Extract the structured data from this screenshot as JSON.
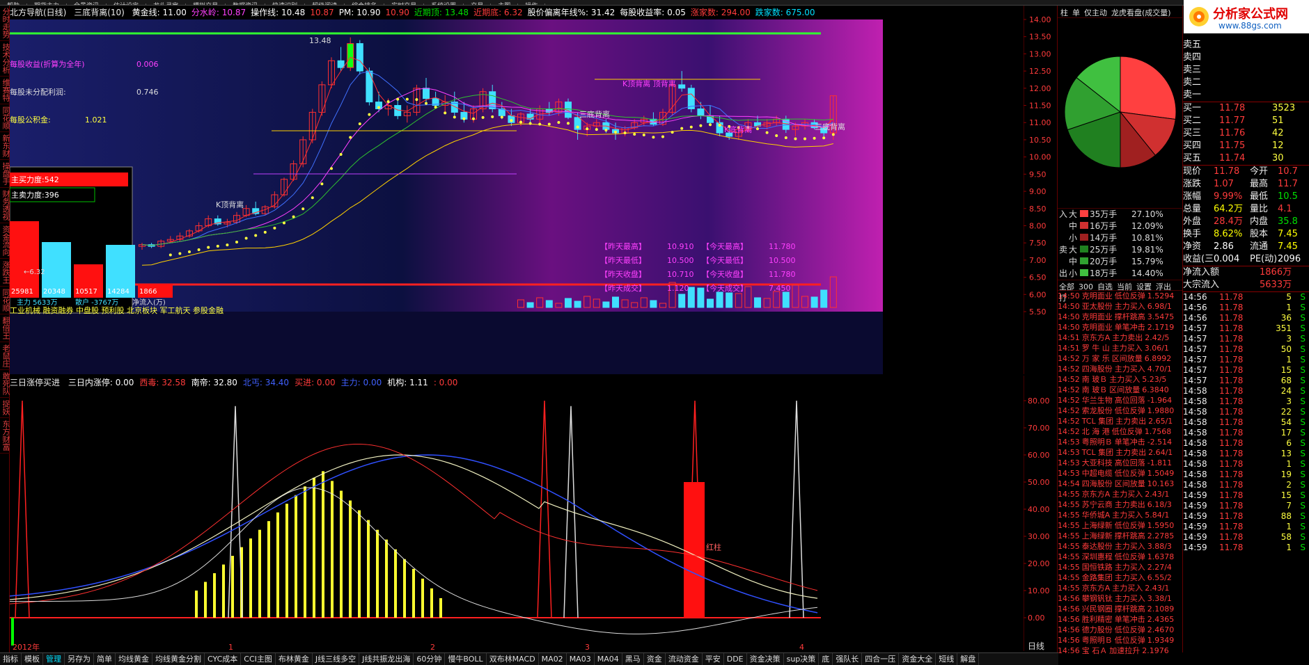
{
  "menu": [
    "帮助",
    "期货主力",
    "全景资讯",
    "估计设定",
    "龙头寻宝",
    "模拟交易",
    "数据资讯",
    "快速识别",
    "超级阅读",
    "综合排名",
    "实时交易",
    "系统设置",
    "交易",
    "主图",
    "操作"
  ],
  "left_nav": [
    "分时走势",
    "技术分析",
    "维赛特",
    "同花顺",
    "新东财",
    "操盘手",
    "财务透视",
    "资金流向",
    "涨跌王",
    "同花顺",
    "翻倍王",
    "老鼠庄",
    "敢死队",
    "捉妖",
    "东方财富"
  ],
  "main_header": {
    "title": "北方导航(日线)",
    "indicator": "三底背离(10)",
    "items": [
      {
        "label": "黄金线: 11.00",
        "color": "#ffffff"
      },
      {
        "label": "分水岭: 10.87",
        "color": "#ff40ff"
      },
      {
        "label": "操作线: 10.48",
        "color": "#ffffff"
      },
      {
        "label": "10.87",
        "color": "#ff3b3b"
      },
      {
        "label": "PM: 10.90",
        "color": "#ffffff"
      },
      {
        "label": "10.90",
        "color": "#ff3b3b"
      },
      {
        "label": "近期顶: 13.48",
        "color": "#00e000"
      },
      {
        "label": "近期底: 6.32",
        "color": "#ff3b3b"
      },
      {
        "label": "股价偏离年线%: 31.42",
        "color": "#ffffff"
      },
      {
        "label": "每股收益率: 0.05",
        "color": "#ffffff"
      },
      {
        "label": "涨家数: 294.00",
        "color": "#ff3b3b"
      },
      {
        "label": "跌家数: 675.00",
        "color": "#00e0ff"
      }
    ]
  },
  "main_overlay": {
    "eps_label": "每股收益(折算为全年)",
    "eps_value": "0.006",
    "undist_label": "每股未分配利润:",
    "undist_value": "0.746",
    "reserve_label": "每股公积金:",
    "reserve_value": "1.021",
    "buy_strength": "主买力度:542",
    "sell_strength": "主卖力度:396",
    "bars": [
      "25981",
      "20348",
      "10517",
      "14284",
      "1866"
    ],
    "arrow_low": "6.32",
    "flow_label_a": "主力 5633万",
    "flow_label_b": "散户 -3767万",
    "flow_label_c": "净流入(万)",
    "concept": "工业机械 融资融券 中盘股 预利股 北京板块 军工航天 参股金融",
    "peak_label": "13.48",
    "k_top_label": "K顶背离",
    "k_top_label2": "K顶背离 顶背离",
    "bottom_div": "三底背离",
    "bottom_div2": "K底背离",
    "bottom_div3": "三底背离",
    "stats": [
      {
        "label": "【昨天最高】",
        "value": "10.910",
        "label2": "【今天最高】",
        "value2": "11.780"
      },
      {
        "label": "【昨天最低】",
        "value": "10.500",
        "label2": "【今天最低】",
        "value2": "10.500"
      },
      {
        "label": "【昨天收盘】",
        "value": "10.710",
        "label2": "【今天收盘】",
        "value2": "11.780"
      },
      {
        "label": "【昨天成交】",
        "value": "1.120",
        "label2": "【今天成交】",
        "value2": "7.450"
      }
    ]
  },
  "price_axis": [
    "14.00",
    "13.50",
    "13.00",
    "12.50",
    "12.00",
    "11.50",
    "11.00",
    "10.50",
    "10.00",
    "9.50",
    "9.00",
    "8.50",
    "8.00",
    "7.50",
    "7.00",
    "6.50",
    "6.00",
    "5.50"
  ],
  "sub_header": {
    "title": "三日涨停买进",
    "items": [
      {
        "label": "三日内涨停: 0.00",
        "color": "#ffffff"
      },
      {
        "label": "西毒: 32.58",
        "color": "#ff3b3b"
      },
      {
        "label": "南帝: 32.80",
        "color": "#ffffff"
      },
      {
        "label": "北丐: 34.40",
        "color": "#4060ff"
      },
      {
        "label": "买进: 0.00",
        "color": "#ff3b3b"
      },
      {
        "label": "主力: 0.00",
        "color": "#4060ff"
      },
      {
        "label": "机构: 1.11",
        "color": "#ffffff"
      },
      {
        "label": ": 0.00",
        "color": "#ff3b3b"
      }
    ],
    "red_col_label": "红柱"
  },
  "sub_axis": [
    "80.00",
    "70.00",
    "60.00",
    "50.00",
    "40.00",
    "30.00",
    "20.00",
    "10.00",
    "0.00"
  ],
  "x_axis": [
    "2012年",
    "1",
    "2",
    "3",
    "4"
  ],
  "tabs": [
    "指标",
    "模板",
    "管理",
    "另存为",
    "简单",
    "均线黄金",
    "均线黄金分割",
    "CYC成本",
    "CCI主图",
    "布林黄金",
    "J线三线多空",
    "J线共振龙出海",
    "60分钟",
    "慢牛BOLL",
    "双布林MACD",
    "MA02",
    "MA03",
    "MA04",
    "黑马",
    "资金",
    "流动资金",
    "平安",
    "DDE",
    "资金决策",
    "sup决策",
    "底",
    "强队长",
    "四合一压",
    "资金大全",
    "短线",
    "解盘"
  ],
  "tabs_active": "管理",
  "period": "日线",
  "flow_panel": {
    "tabs": [
      "柱",
      "单",
      "仅主动",
      "龙虎看盘(成交量)"
    ],
    "pie": [
      {
        "value": 27.1,
        "color": "#ff4040"
      },
      {
        "value": 12.09,
        "color": "#d03030"
      },
      {
        "value": 10.81,
        "color": "#a02020"
      },
      {
        "value": 19.81,
        "color": "#208020"
      },
      {
        "value": 15.79,
        "color": "#30a030"
      },
      {
        "value": 14.4,
        "color": "#40c040"
      }
    ],
    "in_rows": [
      {
        "side": "入",
        "size": "大",
        "amount": "35万手",
        "pct": "27.10%",
        "color": "#ff4040"
      },
      {
        "side": "",
        "size": "中",
        "amount": "16万手",
        "pct": "12.09%",
        "color": "#d03030"
      },
      {
        "side": "",
        "size": "小",
        "amount": "14万手",
        "pct": "10.81%",
        "color": "#a02020"
      }
    ],
    "out_rows": [
      {
        "side": "卖",
        "size": "大",
        "amount": "25万手",
        "pct": "19.81%",
        "color": "#208020"
      },
      {
        "side": "",
        "size": "中",
        "amount": "20万手",
        "pct": "15.79%",
        "color": "#30a030"
      },
      {
        "side": "出",
        "size": "小",
        "amount": "18万手",
        "pct": "14.40%",
        "color": "#40c040"
      }
    ],
    "list_tabs": [
      "全部",
      "300",
      "自选",
      "当前",
      "设置",
      "浮出",
      "打"
    ],
    "news": [
      {
        "time": "14:50",
        "name": "克明面业",
        "event": "低位反弹",
        "val": "1.5294"
      },
      {
        "time": "14:50",
        "name": "亚太股份",
        "event": "主力买入",
        "val": "6.98/1"
      },
      {
        "time": "14:50",
        "name": "克明面业",
        "event": "撑杆跳高",
        "val": "3.5475"
      },
      {
        "time": "14:50",
        "name": "克明面业",
        "event": "单笔冲击",
        "val": "2.1719"
      },
      {
        "time": "14:51",
        "name": "京东方A",
        "event": "主力卖出",
        "val": "2.42/5"
      },
      {
        "time": "14:51",
        "name": "罗 牛 山",
        "event": "主力买入",
        "val": "3.06/1"
      },
      {
        "time": "14:52",
        "name": "万 家 乐",
        "event": "区间放量",
        "val": "6.8992"
      },
      {
        "time": "14:52",
        "name": "四海股份",
        "event": "主力买入",
        "val": "4.70/1"
      },
      {
        "time": "14:52",
        "name": "南 玻Ｂ",
        "event": "主力买入",
        "val": "5.23/5"
      },
      {
        "time": "14:52",
        "name": "南 玻Ｂ",
        "event": "区间放量",
        "val": "6.3840"
      },
      {
        "time": "14:52",
        "name": "华兰生物",
        "event": "高位回落",
        "val": "-1.964"
      },
      {
        "time": "14:52",
        "name": "索龙股份",
        "event": "低位反弹",
        "val": "1.9880"
      },
      {
        "time": "14:52",
        "name": "TCL 集团",
        "event": "主力卖出",
        "val": "2.65/1"
      },
      {
        "time": "14:52",
        "name": "北 海 港",
        "event": "低位反弹",
        "val": "1.7568"
      },
      {
        "time": "14:53",
        "name": "粤照明Ｂ",
        "event": "单笔冲击",
        "val": "-2.514"
      },
      {
        "time": "14:53",
        "name": "TCL 集团",
        "event": "主力卖出",
        "val": "2.64/1"
      },
      {
        "time": "14:53",
        "name": "大亚科技",
        "event": "高位回落",
        "val": "-1.811"
      },
      {
        "time": "14:53",
        "name": "中超电缆",
        "event": "低位反弹",
        "val": "1.5049"
      },
      {
        "time": "14:54",
        "name": "四海股份",
        "event": "区间放量",
        "val": "10.163"
      },
      {
        "time": "14:55",
        "name": "京东方A",
        "event": "主力买入",
        "val": "2.43/1"
      },
      {
        "time": "14:55",
        "name": "苏宁云商",
        "event": "主力卖出",
        "val": "6.18/3"
      },
      {
        "time": "14:55",
        "name": "华侨城A",
        "event": "主力买入",
        "val": "5.84/1"
      },
      {
        "time": "14:55",
        "name": "上海绿新",
        "event": "低位反弹",
        "val": "1.5950"
      },
      {
        "time": "14:55",
        "name": "上海绿新",
        "event": "撑杆跳高",
        "val": "2.2785"
      },
      {
        "time": "14:55",
        "name": "泰达股份",
        "event": "主力买入",
        "val": "3.88/3"
      },
      {
        "time": "14:55",
        "name": "深圳惠程",
        "event": "低位反弹",
        "val": "1.6378"
      },
      {
        "time": "14:55",
        "name": "国恒铁路",
        "event": "主力买入",
        "val": "2.27/4"
      },
      {
        "time": "14:55",
        "name": "金路集团",
        "event": "主力买入",
        "val": "6.55/2"
      },
      {
        "time": "14:55",
        "name": "京东方A",
        "event": "主力买入",
        "val": "2.43/1"
      },
      {
        "time": "14:56",
        "name": "攀钢钒钛",
        "event": "主力买入",
        "val": "3.38/1"
      },
      {
        "time": "14:56",
        "name": "兴民钢圈",
        "event": "撑杆跳高",
        "val": "2.1089"
      },
      {
        "time": "14:56",
        "name": "胜利精密",
        "event": "单笔冲击",
        "val": "2.4365"
      },
      {
        "time": "14:56",
        "name": "德力股份",
        "event": "低位反弹",
        "val": "2.4670"
      },
      {
        "time": "14:56",
        "name": "粤照明Ｂ",
        "event": "低位反弹",
        "val": "1.9349"
      },
      {
        "time": "14:56",
        "name": "宝 石Ａ",
        "event": "加速拉升",
        "val": "2.1976"
      }
    ]
  },
  "quote_panel": {
    "logo_text": "分析家公式网",
    "logo_url": "www.88gs.com",
    "asks": [
      {
        "label": "卖五",
        "price": "",
        "vol": ""
      },
      {
        "label": "卖四",
        "price": "",
        "vol": ""
      },
      {
        "label": "卖三",
        "price": "",
        "vol": ""
      },
      {
        "label": "卖二",
        "price": "",
        "vol": ""
      },
      {
        "label": "卖一",
        "price": "",
        "vol": ""
      }
    ],
    "bids": [
      {
        "label": "买一",
        "price": "11.78",
        "vol": "3523"
      },
      {
        "label": "买二",
        "price": "11.77",
        "vol": "51"
      },
      {
        "label": "买三",
        "price": "11.76",
        "vol": "42"
      },
      {
        "label": "买四",
        "price": "11.75",
        "vol": "12"
      },
      {
        "label": "买五",
        "price": "11.74",
        "vol": "30"
      }
    ],
    "stats": [
      {
        "l1": "现价",
        "v1": "11.78",
        "c1": "#ff3b3b",
        "l2": "今开",
        "v2": "10.7",
        "c2": "#ff3b3b"
      },
      {
        "l1": "涨跌",
        "v1": "1.07",
        "c1": "#ff3b3b",
        "l2": "最高",
        "v2": "11.7",
        "c2": "#ff3b3b"
      },
      {
        "l1": "涨幅",
        "v1": "9.99%",
        "c1": "#ff3b3b",
        "l2": "最低",
        "v2": "10.5",
        "c2": "#00e000"
      },
      {
        "l1": "总量",
        "v1": "64.2万",
        "c1": "#ffff00",
        "l2": "量比",
        "v2": "4.1",
        "c2": "#ff3b3b"
      },
      {
        "l1": "外盘",
        "v1": "28.4万",
        "c1": "#ff3b3b",
        "l2": "内盘",
        "v2": "35.8",
        "c2": "#00e000"
      },
      {
        "l1": "换手",
        "v1": "8.62%",
        "c1": "#ffff00",
        "l2": "股本",
        "v2": "7.45",
        "c2": "#ffff00"
      },
      {
        "l1": "净资",
        "v1": "2.86",
        "c1": "#ffffff",
        "l2": "流通",
        "v2": "7.45",
        "c2": "#ffff00"
      },
      {
        "l1": "收益(三",
        "v1": "0.004",
        "c1": "#ffffff",
        "l2": "PE(动)",
        "v2": "2096",
        "c2": "#ffffff"
      }
    ],
    "net_inflow_label": "净流入额",
    "net_inflow": "1866万",
    "big_inflow_label": "大宗流入",
    "big_inflow": "5633万",
    "ticks": [
      {
        "t": "14:56",
        "p": "11.78",
        "v": "5",
        "s": "S"
      },
      {
        "t": "14:56",
        "p": "11.78",
        "v": "1",
        "s": "S"
      },
      {
        "t": "14:56",
        "p": "11.78",
        "v": "36",
        "s": "S"
      },
      {
        "t": "14:57",
        "p": "11.78",
        "v": "351",
        "s": "S"
      },
      {
        "t": "14:57",
        "p": "11.78",
        "v": "3",
        "s": "S"
      },
      {
        "t": "14:57",
        "p": "11.78",
        "v": "50",
        "s": "S"
      },
      {
        "t": "14:57",
        "p": "11.78",
        "v": "1",
        "s": "S"
      },
      {
        "t": "14:57",
        "p": "11.78",
        "v": "15",
        "s": "S"
      },
      {
        "t": "14:57",
        "p": "11.78",
        "v": "68",
        "s": "S"
      },
      {
        "t": "14:58",
        "p": "11.78",
        "v": "24",
        "s": "S"
      },
      {
        "t": "14:58",
        "p": "11.78",
        "v": "3",
        "s": "S"
      },
      {
        "t": "14:58",
        "p": "11.78",
        "v": "22",
        "s": "S"
      },
      {
        "t": "14:58",
        "p": "11.78",
        "v": "54",
        "s": "S"
      },
      {
        "t": "14:58",
        "p": "11.78",
        "v": "17",
        "s": "S"
      },
      {
        "t": "14:58",
        "p": "11.78",
        "v": "6",
        "s": "S"
      },
      {
        "t": "14:58",
        "p": "11.78",
        "v": "13",
        "s": "S"
      },
      {
        "t": "14:58",
        "p": "11.78",
        "v": "1",
        "s": "S"
      },
      {
        "t": "14:58",
        "p": "11.78",
        "v": "19",
        "s": "S"
      },
      {
        "t": "14:58",
        "p": "11.78",
        "v": "2",
        "s": "S"
      },
      {
        "t": "14:59",
        "p": "11.78",
        "v": "15",
        "s": "S"
      },
      {
        "t": "14:59",
        "p": "11.78",
        "v": "7",
        "s": "S"
      },
      {
        "t": "14:59",
        "p": "11.78",
        "v": "88",
        "s": "S"
      },
      {
        "t": "14:59",
        "p": "11.78",
        "v": "1",
        "s": "S"
      },
      {
        "t": "14:59",
        "p": "11.78",
        "v": "58",
        "s": "S"
      },
      {
        "t": "14:59",
        "p": "11.78",
        "v": "1",
        "s": "S"
      }
    ]
  }
}
